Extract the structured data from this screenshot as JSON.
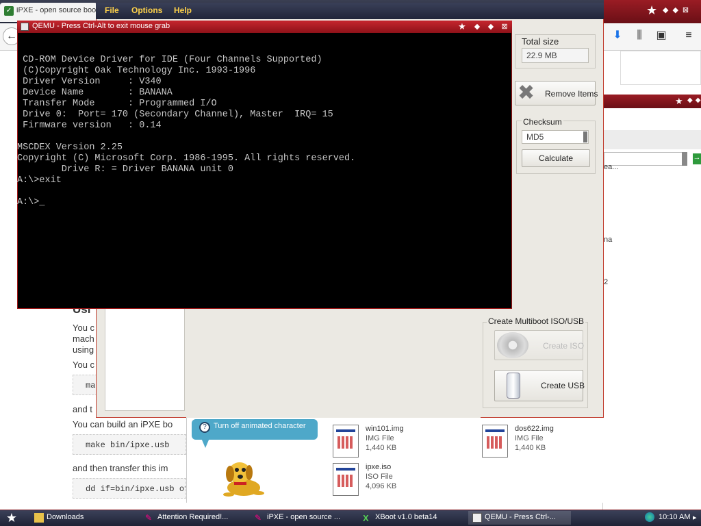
{
  "browser": {
    "tab_title": "iPXE - open source boo",
    "page": {
      "heading_partial": "Usi",
      "para1": [
        "You c",
        "mach",
        "using"
      ],
      "para2": "You c",
      "code1": "ma",
      "para3": "and t",
      "para4": "You can build an iPXE bo",
      "code2": "make bin/ipxe.usb",
      "para5": "and then transfer this im",
      "code3": "dd if=bin/ipxe.usb of"
    },
    "right_fragments": [
      "ea...",
      "na",
      "2"
    ]
  },
  "xboot": {
    "menu": [
      "File",
      "Options",
      "Help"
    ],
    "total_size_label": "Total size",
    "total_size_value": "22.9 MB",
    "remove_items_label": "Remove Items",
    "checksum_label": "Checksum",
    "checksum_algo": "MD5",
    "calculate_label": "Calculate",
    "create_group_label": "Create Multiboot ISO/USB",
    "create_iso_label": "Create ISO",
    "create_usb_label": "Create USB"
  },
  "qemu": {
    "title": "QEMU - Press Ctrl-Alt to exit mouse grab",
    "console": " CD-ROM Device Driver for IDE (Four Channels Supported)\n (C)Copyright Oak Technology Inc. 1993-1996\n Driver Version     : V340\n Device Name        : BANANA\n Transfer Mode      : Programmed I/O\n Drive 0:  Port= 170 (Secondary Channel), Master  IRQ= 15\n Firmware version   : 0.14\n\nMSCDEX Version 2.25\nCopyright (C) Microsoft Corp. 1986-1995. All rights reserved.\n        Drive R: = Driver BANANA unit 0\nA:\\>exit\n\nA:\\>_"
  },
  "explorer": {
    "assistant_text": "Turn off animated character",
    "files": [
      {
        "name": "win101.img",
        "type": "IMG File",
        "size": "1,440 KB"
      },
      {
        "name": "dos622.img",
        "type": "IMG File",
        "size": "1,440 KB"
      },
      {
        "name": "ipxe.iso",
        "type": "ISO File",
        "size": "4,096 KB"
      }
    ]
  },
  "taskbar": {
    "tasks": [
      "Downloads",
      "Attention Required!...",
      "iPXE - open source ...",
      "XBoot v1.0 beta14",
      "QEMU - Press Ctrl-..."
    ],
    "clock": "10:10 AM"
  },
  "colors": {
    "accent": "#c6262e",
    "taskbar": "#23273a",
    "console_text": "#c8c8c8"
  }
}
